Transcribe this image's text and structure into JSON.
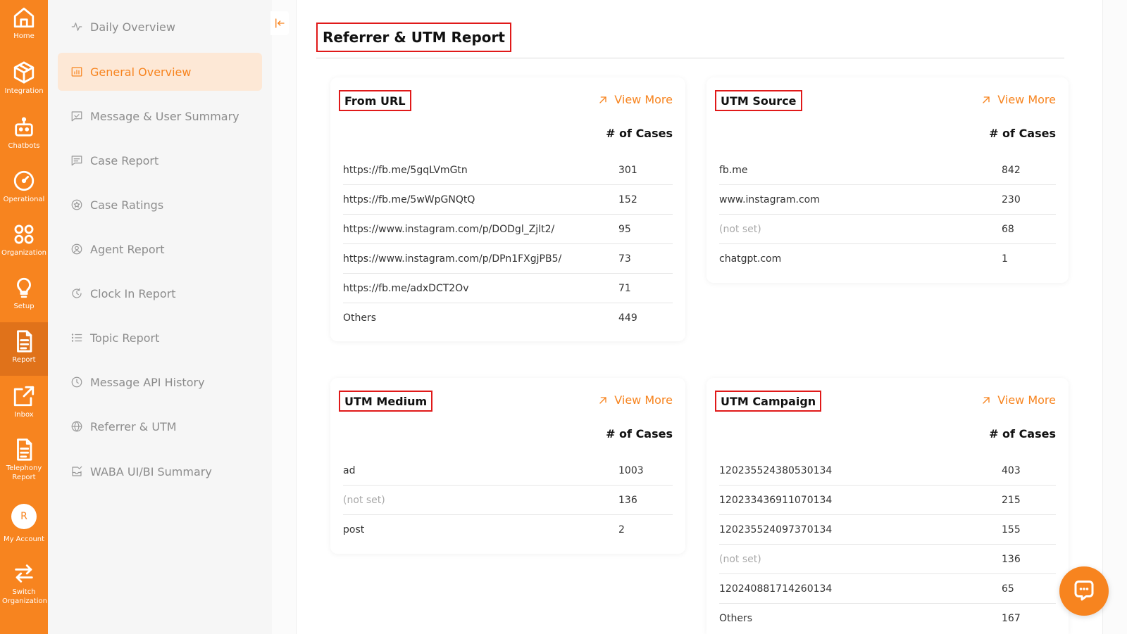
{
  "colors": {
    "accent": "#f7841f",
    "highlight_box": "#e01919",
    "active_bg": "#fde8d6"
  },
  "rail": [
    {
      "label": "Home",
      "icon": "home-icon"
    },
    {
      "label": "Integration",
      "icon": "cube-icon"
    },
    {
      "label": "Chatbots",
      "icon": "robot-icon"
    },
    {
      "label": "Operational",
      "icon": "gauge-icon"
    },
    {
      "label": "Organization",
      "icon": "apps-icon"
    },
    {
      "label": "Setup",
      "icon": "lightbulb-icon"
    },
    {
      "label": "Report",
      "icon": "report-icon",
      "active": true
    },
    {
      "label": "Inbox",
      "icon": "external-link-icon"
    },
    {
      "label": "Telephony Report",
      "icon": "document-icon"
    },
    {
      "label": "My Account",
      "icon": "avatar",
      "avatar_letter": "R"
    },
    {
      "label": "Switch Organization",
      "icon": "switch-icon"
    }
  ],
  "sidebar": {
    "items": [
      {
        "label": "Daily Overview",
        "icon": "pulse-icon"
      },
      {
        "label": "General Overview",
        "icon": "chart-icon",
        "active": true
      },
      {
        "label": "Message & User Summary",
        "icon": "message-check-icon"
      },
      {
        "label": "Case Report",
        "icon": "message-lines-icon"
      },
      {
        "label": "Case Ratings",
        "icon": "star-circle-icon"
      },
      {
        "label": "Agent Report",
        "icon": "user-circle-icon"
      },
      {
        "label": "Clock In Report",
        "icon": "clock-refresh-icon"
      },
      {
        "label": "Topic Report",
        "icon": "list-icon"
      },
      {
        "label": "Message API History",
        "icon": "clock-icon"
      },
      {
        "label": "Referrer & UTM",
        "icon": "globe-icon"
      },
      {
        "label": "WABA UI/BI Summary",
        "icon": "inbox-check-icon"
      }
    ]
  },
  "main": {
    "title": "Referrer & UTM Report",
    "view_more": "View More",
    "col_head": "# of Cases",
    "cards": {
      "from_url": {
        "title": "From URL",
        "rows": [
          {
            "key": "https://fb.me/5gqLVmGtn",
            "value": "301"
          },
          {
            "key": "https://fb.me/5wWpGNQtQ",
            "value": "152"
          },
          {
            "key": "https://www.instagram.com/p/DODgl_Zjlt2/",
            "value": "95"
          },
          {
            "key": "https://www.instagram.com/p/DPn1FXgjPB5/",
            "value": "73"
          },
          {
            "key": "https://fb.me/adxDCT2Ov",
            "value": "71"
          },
          {
            "key": "Others",
            "value": "449"
          }
        ]
      },
      "utm_source": {
        "title": "UTM Source",
        "rows": [
          {
            "key": "fb.me",
            "value": "842"
          },
          {
            "key": "www.instagram.com",
            "value": "230"
          },
          {
            "key": "(not set)",
            "value": "68",
            "muted": true
          },
          {
            "key": "chatgpt.com",
            "value": "1"
          }
        ]
      },
      "utm_medium": {
        "title": "UTM Medium",
        "rows": [
          {
            "key": "ad",
            "value": "1003"
          },
          {
            "key": "(not set)",
            "value": "136",
            "muted": true
          },
          {
            "key": "post",
            "value": "2"
          }
        ]
      },
      "utm_campaign": {
        "title": "UTM Campaign",
        "rows": [
          {
            "key": "120235524380530134",
            "value": "403"
          },
          {
            "key": "120233436911070134",
            "value": "215"
          },
          {
            "key": "120235524097370134",
            "value": "155"
          },
          {
            "key": "(not set)",
            "value": "136",
            "muted": true
          },
          {
            "key": "120240881714260134",
            "value": "65"
          },
          {
            "key": "Others",
            "value": "167"
          }
        ]
      }
    }
  }
}
